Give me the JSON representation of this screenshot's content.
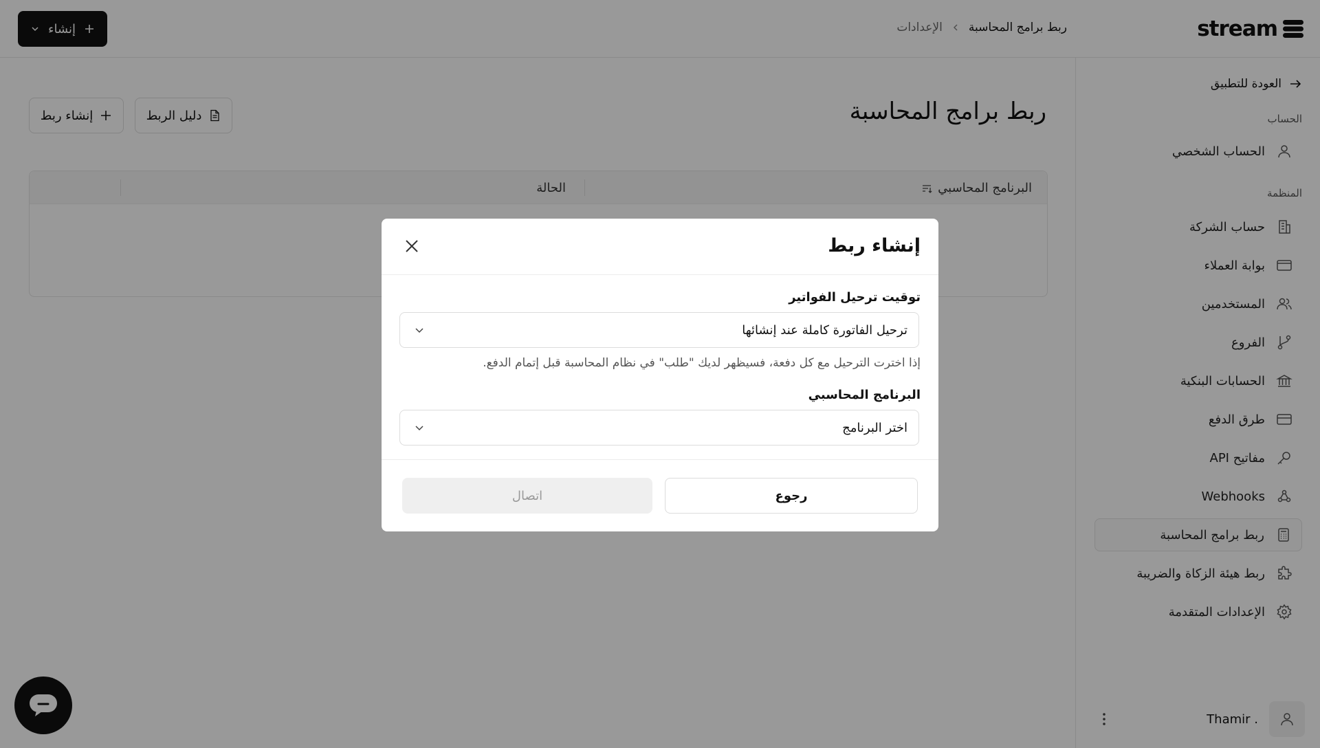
{
  "header": {
    "logo_text": "stream",
    "breadcrumb": {
      "parent": "الإعدادات",
      "current": "ربط برامج المحاسبة"
    },
    "create_button": "إنشاء"
  },
  "sidebar": {
    "back_link": "العودة للتطبيق",
    "section_account": "الحساب",
    "section_org": "المنظمة",
    "items": [
      {
        "label": "الحساب الشخصي",
        "icon": "user-icon"
      },
      {
        "label": "حساب الشركة",
        "icon": "building-icon"
      },
      {
        "label": "بوابة العملاء",
        "icon": "browser-window-icon"
      },
      {
        "label": "المستخدمين",
        "icon": "users-icon"
      },
      {
        "label": "الفروع",
        "icon": "git-branch-icon"
      },
      {
        "label": "الحسابات البنكية",
        "icon": "bank-icon"
      },
      {
        "label": "طرق الدفع",
        "icon": "credit-card-icon"
      },
      {
        "label": "مفاتيح API",
        "icon": "key-icon"
      },
      {
        "label": "Webhooks",
        "icon": "webhook-icon"
      },
      {
        "label": "ربط برامج المحاسبة",
        "icon": "calculator-icon",
        "active": true
      },
      {
        "label": "ربط هيئة الزكاة والضريبة",
        "icon": "puzzle-icon"
      },
      {
        "label": "الإعدادات المتقدمة",
        "icon": "gear-icon"
      }
    ],
    "user_name": ". Thamir"
  },
  "main": {
    "title": "ربط برامج المحاسبة",
    "guide_button": "دليل الربط",
    "create_link_button": "إنشاء ربط",
    "table": {
      "columns": [
        "البرنامج المحاسبي",
        "الحالة"
      ]
    }
  },
  "modal": {
    "title": "إنشاء ربط",
    "timing_label": "توقيت ترحيل الفواتير",
    "timing_value": "ترحيل الفاتورة كاملة عند إنشائها",
    "timing_help": "إذا اخترت الترحيل مع كل دفعة، فسيظهر لديك \"طلب\" في نظام المحاسبة قبل إتمام الدفع.",
    "software_label": "البرنامج المحاسبي",
    "software_placeholder": "اختر البرنامج",
    "back_button": "رجوع",
    "connect_button": "اتصال"
  },
  "colors": {
    "primary": "#111111",
    "overlay": "rgba(0,0,0,0.4)",
    "disabled_bg": "#efefef",
    "disabled_text": "#999999"
  }
}
